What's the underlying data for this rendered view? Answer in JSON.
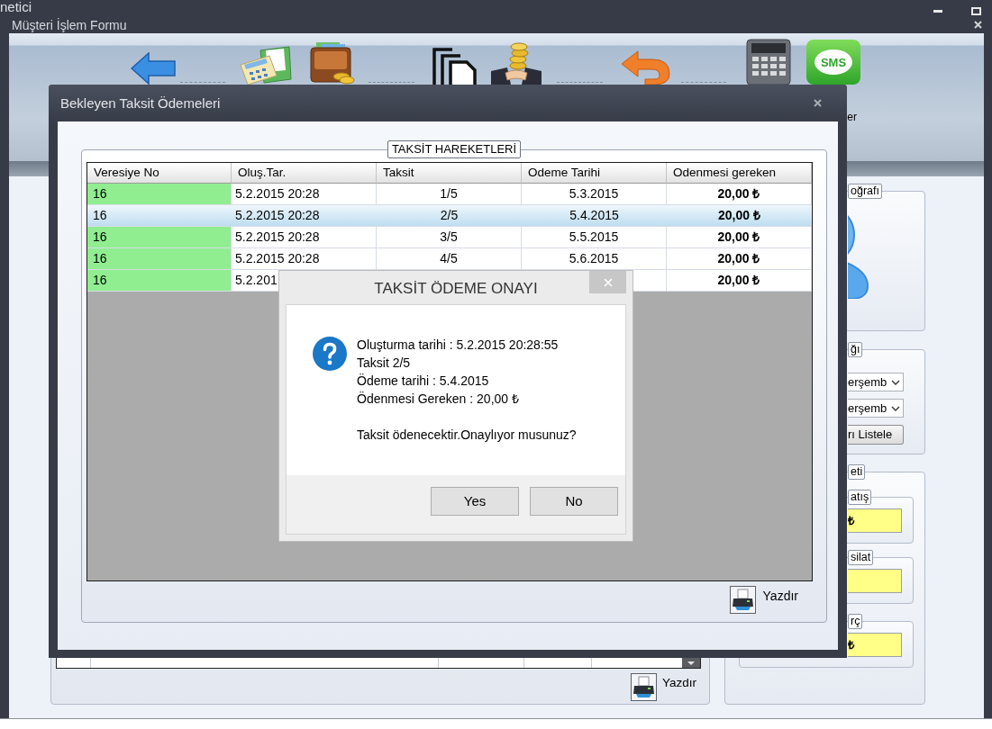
{
  "app_title_bar": {
    "title": "netici"
  },
  "form_window": {
    "title": "Müşteri İşlem Formu"
  },
  "toolbar": {
    "sms_icon_text": "SMS",
    "cut_label": "er"
  },
  "photo_panel": {
    "legend": "oğrafı"
  },
  "date_panel": {
    "legend": "ğı",
    "dropdowns": [
      {
        "value": "erşemb"
      },
      {
        "value": "erşemb"
      }
    ],
    "list_button": "rı Listele"
  },
  "totals_panel": {
    "legend": "eti",
    "boxes": [
      {
        "legend": "atış",
        "value": "₺"
      },
      {
        "legend": "silat"
      },
      {
        "legend": "rç",
        "value": "₺"
      }
    ]
  },
  "list_panel": {
    "print_button": "Yazdır"
  },
  "modal": {
    "title": "Bekleyen Taksit Ödemeleri",
    "group_legend": "TAKSİT HAREKETLERİ",
    "table": {
      "columns": [
        "Veresiye No",
        "Oluş.Tar.",
        "Taksit",
        "Odeme Tarihi",
        "Odenmesi gereken"
      ],
      "rows": [
        {
          "veresiye_no": "16",
          "olus_tar": "5.2.2015 20:28",
          "taksit": "1/5",
          "odeme_tarihi": "5.3.2015",
          "odenmesi_gereken": "20,00 ₺",
          "selected": false,
          "color": "#90ee90"
        },
        {
          "veresiye_no": "16",
          "olus_tar": "5.2.2015 20:28",
          "taksit": "2/5",
          "odeme_tarihi": "5.4.2015",
          "odenmesi_gereken": "20,00 ₺",
          "selected": true
        },
        {
          "veresiye_no": "16",
          "olus_tar": "5.2.2015 20:28",
          "taksit": "3/5",
          "odeme_tarihi": "5.5.2015",
          "odenmesi_gereken": "20,00 ₺",
          "selected": false,
          "color": "#90ee90"
        },
        {
          "veresiye_no": "16",
          "olus_tar": "5.2.2015 20:28",
          "taksit": "4/5",
          "odeme_tarihi": "5.6.2015",
          "odenmesi_gereken": "20,00 ₺",
          "selected": false,
          "color": "#90ee90"
        },
        {
          "veresiye_no": "16",
          "olus_tar": "5.2.201",
          "odenmesi_gereken": "20,00 ₺",
          "selected": false,
          "color": "#90ee90"
        }
      ]
    },
    "print_button": "Yazdır"
  },
  "confirm_dialog": {
    "title": "TAKSİT ÖDEME ONAYI",
    "details": [
      "Oluşturma tarihi : 5.2.2015 20:28:55",
      "Taksit 2/5",
      "Ödeme tarihi : 5.4.2015",
      "Ödenmesi Gereken : 20,00 ₺"
    ],
    "question": "Taksit ödenecektir.Onaylıyor musunuz?",
    "buttons": [
      "Yes",
      "No"
    ]
  }
}
